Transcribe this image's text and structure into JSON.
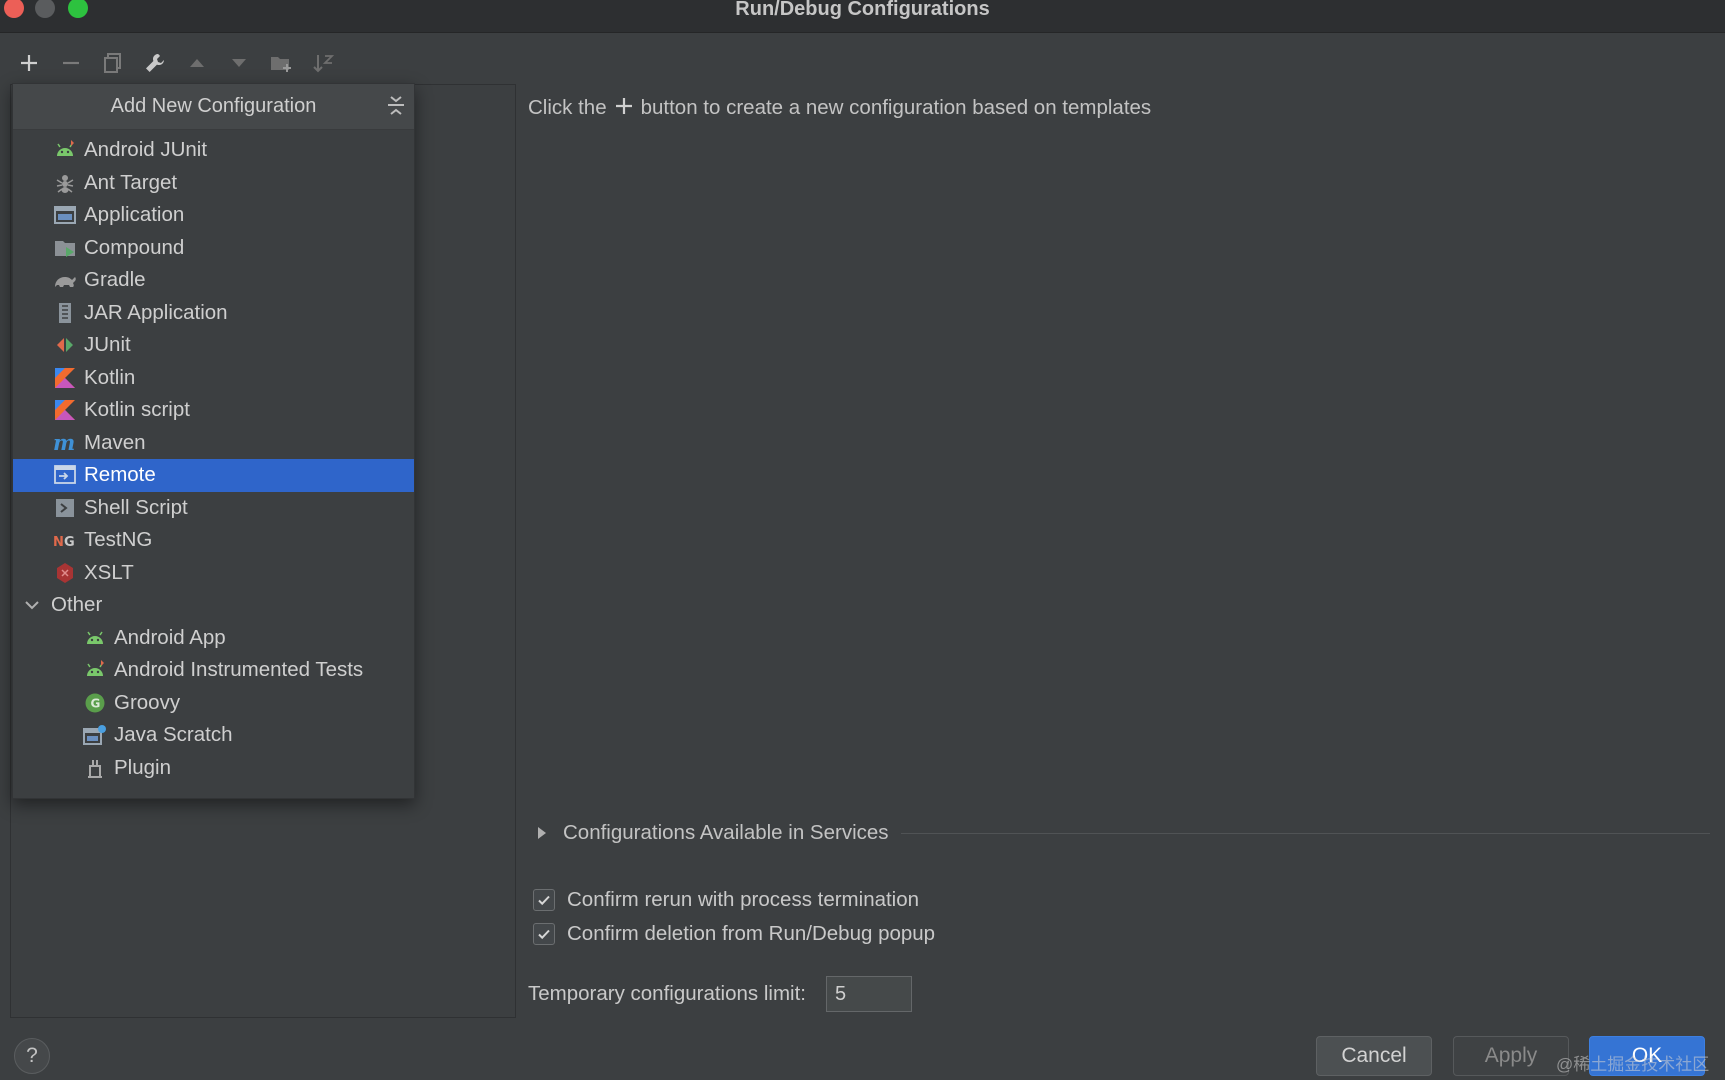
{
  "window": {
    "title": "Run/Debug Configurations"
  },
  "toolbar": {
    "buttons": [
      {
        "icon": "plus-icon",
        "active": true
      },
      {
        "icon": "minus-icon",
        "active": false
      },
      {
        "icon": "copy-icon",
        "active": false
      },
      {
        "icon": "wrench-icon",
        "active": true
      },
      {
        "icon": "arrow-up-icon",
        "active": false
      },
      {
        "icon": "arrow-down-icon",
        "active": false
      },
      {
        "icon": "folder-add-icon",
        "active": false
      },
      {
        "icon": "sort-icon",
        "active": false
      }
    ]
  },
  "popup": {
    "title": "Add New Configuration",
    "items": [
      {
        "label": "Android JUnit",
        "icon": "android-junit-icon"
      },
      {
        "label": "Ant Target",
        "icon": "ant-icon"
      },
      {
        "label": "Application",
        "icon": "application-icon"
      },
      {
        "label": "Compound",
        "icon": "compound-icon"
      },
      {
        "label": "Gradle",
        "icon": "gradle-icon"
      },
      {
        "label": "JAR Application",
        "icon": "jar-icon"
      },
      {
        "label": "JUnit",
        "icon": "junit-icon"
      },
      {
        "label": "Kotlin",
        "icon": "kotlin-icon"
      },
      {
        "label": "Kotlin script",
        "icon": "kotlin-icon"
      },
      {
        "label": "Maven",
        "icon": "maven-icon"
      },
      {
        "label": "Remote",
        "icon": "remote-icon",
        "selected": true
      },
      {
        "label": "Shell Script",
        "icon": "shell-script-icon"
      },
      {
        "label": "TestNG",
        "icon": "testng-icon"
      },
      {
        "label": "XSLT",
        "icon": "xslt-icon"
      }
    ],
    "other_group": {
      "label": "Other",
      "items": [
        {
          "label": "Android App",
          "icon": "android-icon"
        },
        {
          "label": "Android Instrumented Tests",
          "icon": "android-junit-icon"
        },
        {
          "label": "Groovy",
          "icon": "groovy-icon"
        },
        {
          "label": "Java Scratch",
          "icon": "java-scratch-icon"
        },
        {
          "label": "Plugin",
          "icon": "plugin-icon"
        }
      ]
    }
  },
  "main": {
    "hint_before": "Click the",
    "hint_after": "button to create a new configuration based on templates",
    "services_label": "Configurations Available in Services",
    "confirm_rerun": "Confirm rerun with process termination",
    "confirm_deletion": "Confirm deletion from Run/Debug popup",
    "confirm_rerun_checked": true,
    "confirm_deletion_checked": true,
    "limit_label": "Temporary configurations limit:",
    "limit_value": "5"
  },
  "footer": {
    "help": "?",
    "cancel": "Cancel",
    "apply": "Apply",
    "ok": "OK",
    "watermark": "@稀土掘金技术社区"
  },
  "colors": {
    "background": "#3c3f41",
    "selection": "#2f65ca",
    "ok_button": "#3574d4"
  }
}
